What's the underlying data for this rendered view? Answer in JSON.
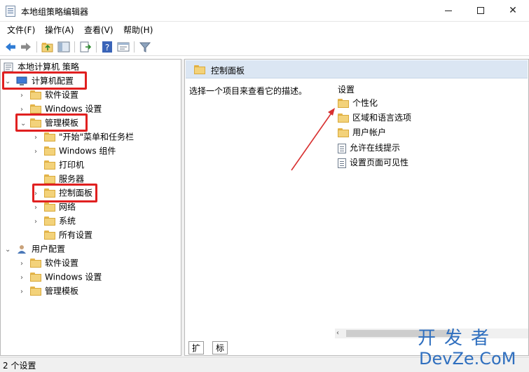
{
  "window": {
    "title": "本地组策略编辑器"
  },
  "menu": [
    "文件(F)",
    "操作(A)",
    "查看(V)",
    "帮助(H)"
  ],
  "toolbar": {
    "icons": [
      "back-icon",
      "forward-icon",
      "up-folder-icon",
      "show-hide-tree-icon",
      "export-list-icon",
      "help-icon",
      "properties-icon",
      "filter-icon"
    ]
  },
  "tree": {
    "root": "本地计算机 策略",
    "computer_config": "计算机配置",
    "software_settings": "软件设置",
    "windows_settings": "Windows 设置",
    "admin_templates": "管理模板",
    "start_menu": "\"开始\"菜单和任务栏",
    "windows_components": "Windows 组件",
    "printers": "打印机",
    "server": "服务器",
    "control_panel": "控制面板",
    "network": "网络",
    "system": "系统",
    "all_settings": "所有设置",
    "user_config": "用户配置",
    "user_software_settings": "软件设置",
    "user_windows_settings": "Windows 设置",
    "user_admin_templates": "管理模板"
  },
  "right_pane": {
    "header": "控制面板",
    "description": "选择一个项目来查看它的描述。",
    "column_header": "设置",
    "items": [
      {
        "label": "个性化",
        "icon": "folder-icon"
      },
      {
        "label": "区域和语言选项",
        "icon": "folder-icon"
      },
      {
        "label": "用户帐户",
        "icon": "folder-icon"
      },
      {
        "label": "允许在线提示",
        "icon": "setting-icon"
      },
      {
        "label": "设置页面可见性",
        "icon": "setting-icon"
      }
    ]
  },
  "tabs": [
    "扩展",
    "标准"
  ],
  "status": "2 个设置",
  "watermark": {
    "top": "开发者",
    "bottom": "DevZe.CoM"
  },
  "colors": {
    "highlight": "#e02020",
    "arrow": "#d83030",
    "folder": "#f3d27a",
    "header_bg": "#dbe6f3",
    "watermark": "#2f6fbf"
  }
}
